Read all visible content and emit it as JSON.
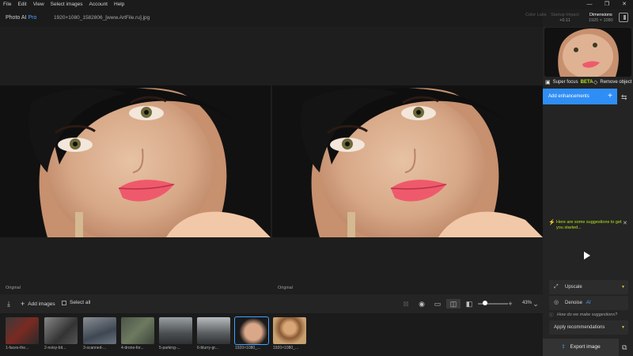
{
  "menu": [
    "File",
    "Edit",
    "View",
    "Select images",
    "Account",
    "Help"
  ],
  "window_controls": {
    "minimize": "—",
    "restore": "❐",
    "close": "✕"
  },
  "app": {
    "name": "Photo AI",
    "badge": "Pro"
  },
  "file": {
    "name": "1920×1080_1582806_[www.ArtFile.ru].jpg"
  },
  "header_info": {
    "col1": {
      "label": "Color Labs",
      "value": ""
    },
    "col2": {
      "label": "Startup Impact",
      "value": "+0.11"
    },
    "dimensions": {
      "label": "Dimensions",
      "value": "1920 × 1080"
    }
  },
  "canvas": {
    "left_label": "Original",
    "right_label": "Original"
  },
  "toolbar": {
    "add_images": "Add images",
    "select_all": "Select all",
    "zoom": "43%",
    "zoom_level": 0.43
  },
  "thumbnails": [
    {
      "caption": "1-faces-the...",
      "selected": false
    },
    {
      "caption": "2-noisy-bit...",
      "selected": false
    },
    {
      "caption": "3-scanned-...",
      "selected": false
    },
    {
      "caption": "4-drone-for...",
      "selected": false
    },
    {
      "caption": "5-parking-...",
      "selected": false
    },
    {
      "caption": "6-blurry-gr...",
      "selected": false
    },
    {
      "caption": "1920×1080_...",
      "selected": true
    },
    {
      "caption": "1920×1080_...",
      "selected": false
    }
  ],
  "sidebar": {
    "super_focus": "Super focus",
    "beta": "BETA",
    "remove_object": "Remove object",
    "add_enhancements": "Add enhancements",
    "suggestion": "Here are some suggestions to get you started...",
    "upscale": "Upscale",
    "denoise": "Denoise",
    "denoise_badge": "AI",
    "how": "How do we make suggestions?",
    "apply": "Apply recommendations",
    "export": "Export image"
  },
  "colors": {
    "accent": "#2f8ef5",
    "beta": "#b6e61a",
    "selected_thumb": "#3fa0ff"
  }
}
